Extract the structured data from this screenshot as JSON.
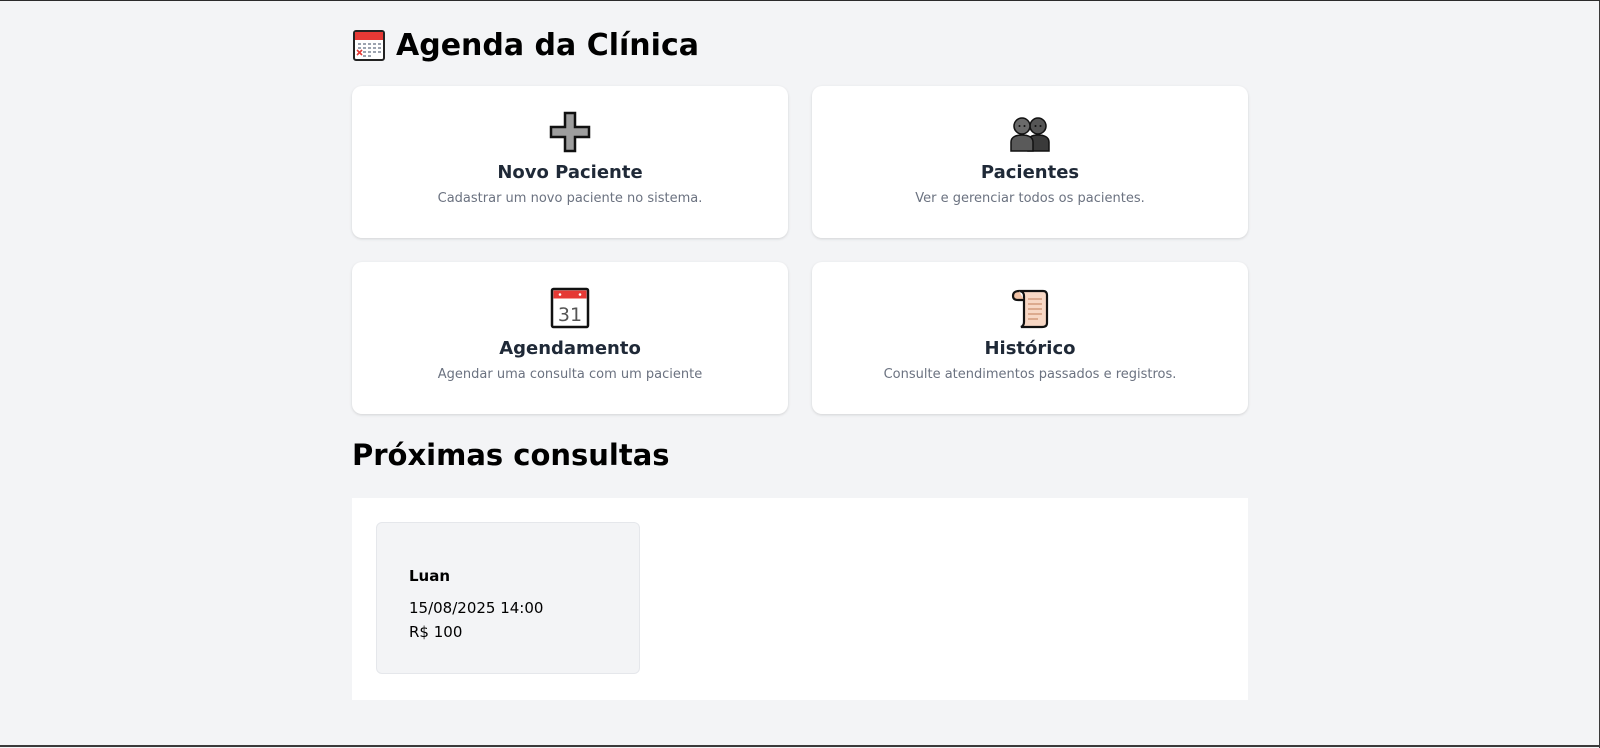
{
  "header": {
    "title": "Agenda da Clínica",
    "icon": "calendar-icon"
  },
  "cards": [
    {
      "icon": "plus-icon",
      "title": "Novo Paciente",
      "description": "Cadastrar um novo paciente no sistema."
    },
    {
      "icon": "people-icon",
      "title": "Pacientes",
      "description": "Ver e gerenciar todos os pacientes."
    },
    {
      "icon": "calendar-31-icon",
      "title": "Agendamento",
      "description": "Agendar uma consulta com um paciente"
    },
    {
      "icon": "scroll-icon",
      "title": "Histórico",
      "description": "Consulte atendimentos passados e registros."
    }
  ],
  "upcoming": {
    "title": "Próximas consultas",
    "appointments": [
      {
        "name": "Luan",
        "datetime": "15/08/2025 14:00",
        "price": "R$ 100"
      }
    ]
  },
  "calendar_day": "31",
  "colors": {
    "background": "#f3f4f6",
    "card": "#ffffff",
    "title_text": "#1f2937",
    "muted_text": "#6b7280",
    "calendar_red": "#e53935"
  }
}
